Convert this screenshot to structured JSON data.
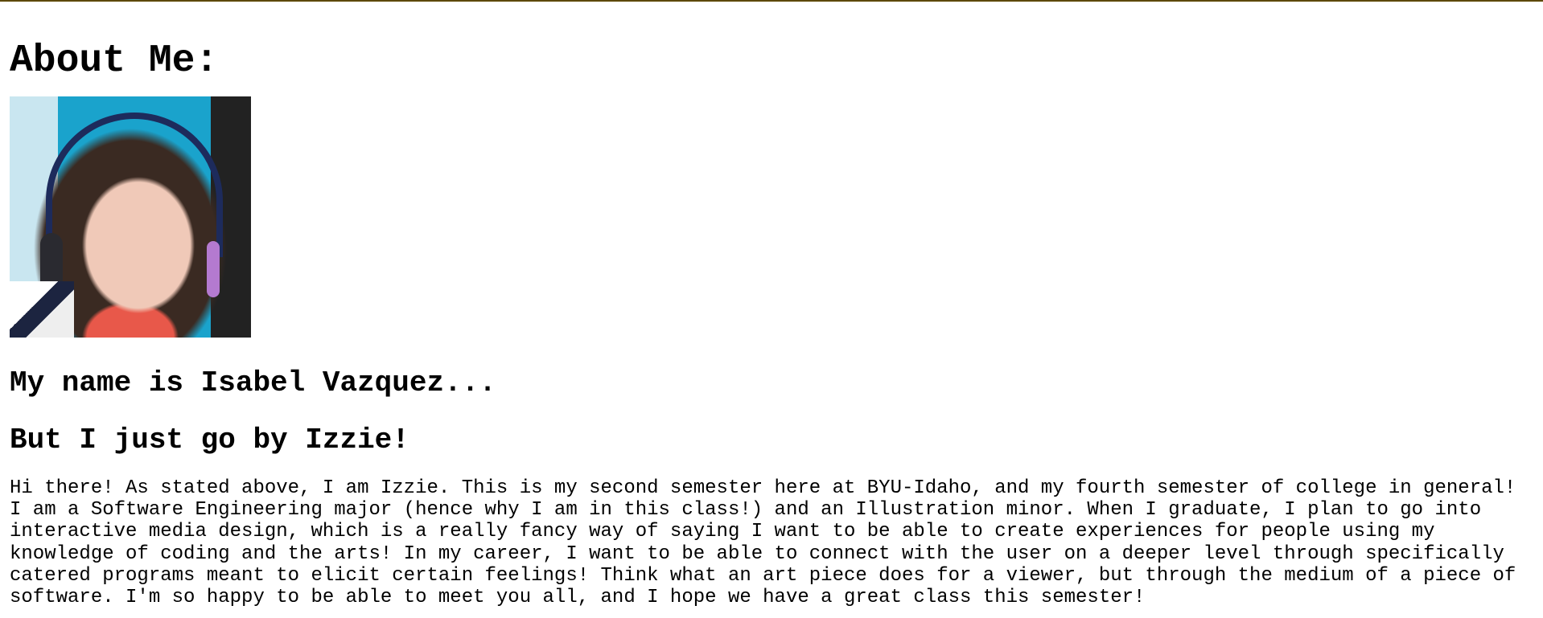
{
  "page": {
    "title": "About Me:",
    "photo_alt": "Photo of Izzie",
    "name_heading": "My name is Isabel Vazquez...",
    "nickname_heading": "But I just go by Izzie!",
    "bio": "Hi there! As stated above, I am Izzie. This is my second semester here at BYU-Idaho, and my fourth semester of college in general! I am a Software Engineering major (hence why I am in this class!) and an Illustration minor. When I graduate, I plan to go into interactive media design, which is a really fancy way of saying I want to be able to create experiences for people using my knowledge of coding and the arts! In my career, I want to be able to connect with the user on a deeper level through specifically catered programs meant to elicit certain feelings! Think what an art piece does for a viewer, but through the medium of a piece of software. I'm so happy to be able to meet you all, and I hope we have a great class this semester!"
  },
  "colors": {
    "top_border": "#5c4800",
    "text": "#000000"
  }
}
